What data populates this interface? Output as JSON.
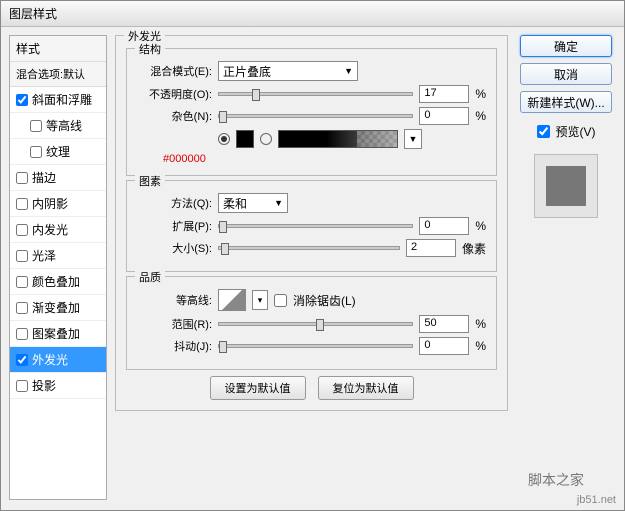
{
  "title": "图层样式",
  "sidebar": {
    "head": "样式",
    "sub": "混合选项:默认",
    "items": [
      {
        "label": "斜面和浮雕",
        "checked": true,
        "indent": false
      },
      {
        "label": "等高线",
        "checked": false,
        "indent": true
      },
      {
        "label": "纹理",
        "checked": false,
        "indent": true
      },
      {
        "label": "描边",
        "checked": false,
        "indent": false
      },
      {
        "label": "内阴影",
        "checked": false,
        "indent": false
      },
      {
        "label": "内发光",
        "checked": false,
        "indent": false
      },
      {
        "label": "光泽",
        "checked": false,
        "indent": false
      },
      {
        "label": "颜色叠加",
        "checked": false,
        "indent": false
      },
      {
        "label": "渐变叠加",
        "checked": false,
        "indent": false
      },
      {
        "label": "图案叠加",
        "checked": false,
        "indent": false
      },
      {
        "label": "外发光",
        "checked": true,
        "indent": false,
        "selected": true
      },
      {
        "label": "投影",
        "checked": false,
        "indent": false
      }
    ]
  },
  "panel": {
    "title": "外发光",
    "struct": {
      "legend": "结构",
      "blend_label": "混合模式(E):",
      "blend_value": "正片叠底",
      "opacity_label": "不透明度(O):",
      "opacity_value": "17",
      "noise_label": "杂色(N):",
      "noise_value": "0",
      "hex": "#000000",
      "pct": "%"
    },
    "elem": {
      "legend": "图素",
      "method_label": "方法(Q):",
      "method_value": "柔和",
      "spread_label": "扩展(P):",
      "spread_value": "0",
      "size_label": "大小(S):",
      "size_value": "2",
      "px": "像素",
      "pct": "%"
    },
    "qual": {
      "legend": "品质",
      "contour_label": "等高线:",
      "antialias_label": "消除锯齿(L)",
      "range_label": "范围(R):",
      "range_value": "50",
      "jitter_label": "抖动(J):",
      "jitter_value": "0",
      "pct": "%"
    },
    "btn_default": "设置为默认值",
    "btn_reset": "复位为默认值"
  },
  "right": {
    "ok": "确定",
    "cancel": "取消",
    "newstyle": "新建样式(W)...",
    "preview": "预览(V)"
  },
  "watermark": "jb51.net",
  "watermark2": "脚本之家"
}
